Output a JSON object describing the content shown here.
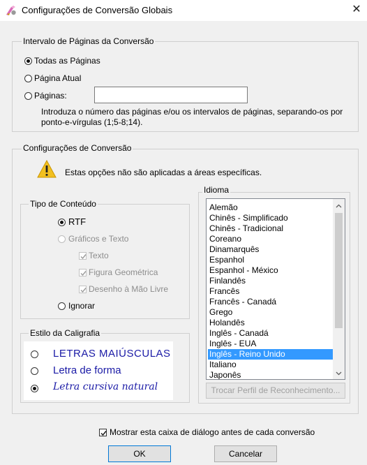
{
  "window": {
    "title": "Configurações de Conversão Globais"
  },
  "page_range": {
    "group_label": "Intervalo de Páginas da Conversão",
    "options": [
      "Todas as Páginas",
      "Página Atual",
      "Páginas:"
    ],
    "pages_value": "",
    "hint": "Introduza o número das páginas e/ou os intervalos de páginas, separando-os por ponto-e-vírgulas (1;5-8;14)."
  },
  "conversion": {
    "group_label": "Configurações de Conversão",
    "warning": "Estas opções não são aplicadas a áreas específicas."
  },
  "content_type": {
    "group_label": "Tipo de Conteúdo",
    "rtf": "RTF",
    "graphics_text": "Gráficos e Texto",
    "text": "Texto",
    "geometric": "Figura Geométrica",
    "freehand": "Desenho à Mão Livre",
    "ignore": "Ignorar"
  },
  "handwriting": {
    "group_label": "Estilo da Caligrafia",
    "uppercase": "LETRAS MAIÚSCULAS",
    "print": "Letra de forma",
    "cursive": "Letra cursiva natural"
  },
  "language": {
    "group_label": "Idioma",
    "items": [
      "Alemão",
      "Chinês - Simplificado",
      "Chinês - Tradicional",
      "Coreano",
      "Dinamarquês",
      "Espanhol",
      "Espanhol - México",
      "Finlandês",
      "Francês",
      "Francês - Canadá",
      "Grego",
      "Holandês",
      "Inglês - Canadá",
      "Inglês - EUA",
      "Inglês - Reino Unido",
      "Italiano",
      "Japonês"
    ],
    "selected": "Inglês - Reino Unido",
    "profile_button": "Trocar Perfil de Reconhecimento..."
  },
  "footer": {
    "show_dialog": "Mostrar esta caixa de diálogo antes de cada conversão",
    "ok": "OK",
    "cancel": "Cancelar"
  },
  "colors": {
    "selection": "#3399ff",
    "ink": "#1a1aa6",
    "default_button_border": "#0078d7"
  }
}
